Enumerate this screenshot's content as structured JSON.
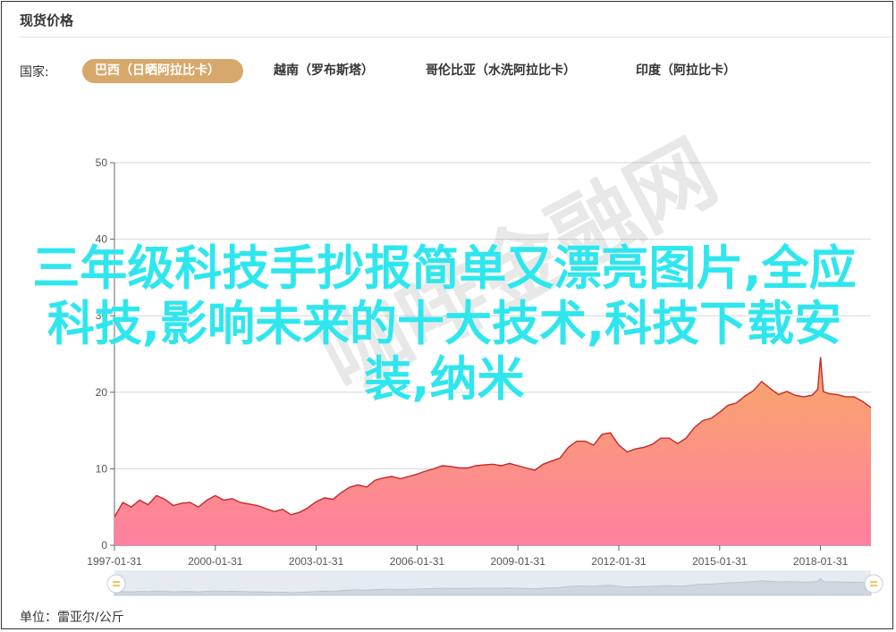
{
  "panel": {
    "title": "现货价格",
    "country_label": "国家:"
  },
  "tabs": [
    {
      "label": "巴西（日晒阿拉比卡）",
      "active": true
    },
    {
      "label": "越南（罗布斯塔）",
      "active": false
    },
    {
      "label": "哥伦比亚（水洗阿拉比卡）",
      "active": false
    },
    {
      "label": "印度（阿拉比卡）",
      "active": false
    }
  ],
  "overlay_text": "三年级科技手抄报简单又漂亮图片,全应科技,影响未来的十大技术,科技下载安装,纳米",
  "watermark": "咖啡金融网",
  "unit": "单位：雷亚尔/公斤",
  "colors": {
    "accent": "#d7a86b",
    "line": "#c62828",
    "fill_top": "#f7a868",
    "fill_bottom": "#ff7fa0",
    "overlay": "#2fe6ee"
  },
  "chart_data": {
    "type": "area",
    "title": "",
    "xlabel": "",
    "ylabel": "",
    "ylim": [
      0,
      50
    ],
    "yticks": [
      0,
      10,
      20,
      30,
      40,
      50
    ],
    "xlim": [
      "1997-01-31",
      "2019-07-31"
    ],
    "xticks": [
      "1997-01-31",
      "2000-01-31",
      "2003-01-31",
      "2006-01-31",
      "2009-01-31",
      "2012-01-31",
      "2015-01-31",
      "2018-01-31"
    ],
    "grid": true,
    "series": [
      {
        "x": [
          "1997-01",
          "1997-04",
          "1997-07",
          "1997-10",
          "1998-01",
          "1998-04",
          "1998-07",
          "1998-10",
          "1999-01",
          "1999-04",
          "1999-07",
          "1999-10",
          "2000-01",
          "2000-04",
          "2000-07",
          "2000-10",
          "2001-01",
          "2001-04",
          "2001-07",
          "2001-10",
          "2002-01",
          "2002-04",
          "2002-07",
          "2002-10",
          "2003-01",
          "2003-04",
          "2003-07",
          "2003-10",
          "2004-01",
          "2004-04",
          "2004-07",
          "2004-10",
          "2005-01",
          "2005-04",
          "2005-07",
          "2005-10",
          "2006-01",
          "2006-04",
          "2006-07",
          "2006-10",
          "2007-01",
          "2007-04",
          "2007-07",
          "2007-10",
          "2008-01",
          "2008-04",
          "2008-07",
          "2008-10",
          "2009-01",
          "2009-04",
          "2009-07",
          "2009-10",
          "2010-01",
          "2010-04",
          "2010-07",
          "2010-10",
          "2011-01",
          "2011-04",
          "2011-07",
          "2011-10",
          "2012-01",
          "2012-04",
          "2012-07",
          "2012-10",
          "2013-01",
          "2013-04",
          "2013-07",
          "2013-10",
          "2014-01",
          "2014-04",
          "2014-07",
          "2014-10",
          "2015-01",
          "2015-04",
          "2015-07",
          "2015-10",
          "2016-01",
          "2016-04",
          "2016-07",
          "2016-10",
          "2017-01",
          "2017-04",
          "2017-07",
          "2017-10",
          "2017-12",
          "2018-01",
          "2018-02",
          "2018-04",
          "2018-07",
          "2018-10",
          "2019-01",
          "2019-04",
          "2019-07"
        ],
        "values": [
          3.7,
          5.6,
          5.0,
          5.9,
          5.3,
          6.5,
          6.0,
          5.2,
          5.5,
          5.6,
          5.0,
          5.9,
          6.5,
          5.9,
          6.1,
          5.6,
          5.4,
          5.2,
          4.8,
          4.4,
          4.7,
          4.0,
          4.3,
          4.9,
          5.7,
          6.2,
          6.0,
          6.9,
          7.6,
          7.9,
          7.6,
          8.5,
          8.8,
          9.0,
          8.7,
          9.0,
          9.3,
          9.7,
          10.0,
          10.4,
          10.3,
          10.1,
          10.1,
          10.4,
          10.5,
          10.6,
          10.4,
          10.7,
          10.4,
          10.1,
          9.8,
          10.6,
          11.0,
          11.4,
          12.8,
          13.6,
          13.6,
          13.1,
          14.5,
          14.7,
          13.1,
          12.2,
          12.6,
          12.8,
          13.2,
          14.0,
          14.0,
          13.3,
          14.0,
          15.4,
          16.3,
          16.6,
          17.4,
          18.3,
          18.6,
          19.5,
          20.2,
          21.4,
          20.5,
          19.7,
          20.1,
          19.6,
          19.4,
          19.6,
          20.4,
          24.6,
          20.1,
          19.8,
          19.7,
          19.4,
          19.4,
          18.8,
          18.0
        ]
      }
    ]
  }
}
